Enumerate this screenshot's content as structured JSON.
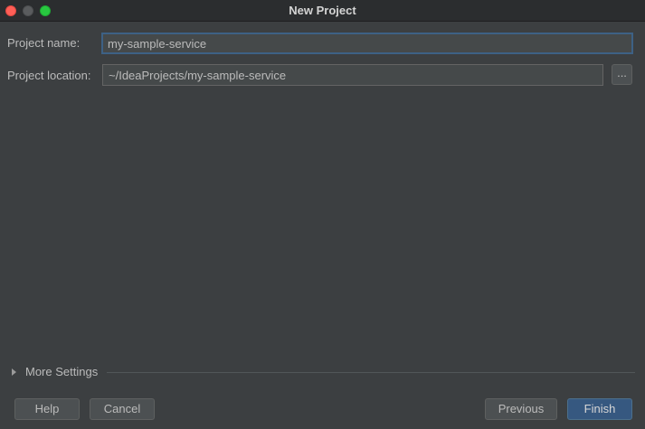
{
  "window": {
    "title": "New Project"
  },
  "form": {
    "project_name_label": "Project name:",
    "project_name_value": "my-sample-service",
    "project_location_label": "Project location:",
    "project_location_value": "~/IdeaProjects/my-sample-service",
    "browse_label": "..."
  },
  "more_settings": {
    "label": "More Settings"
  },
  "buttons": {
    "help": "Help",
    "cancel": "Cancel",
    "previous": "Previous",
    "finish": "Finish"
  },
  "colors": {
    "background": "#3c3f41",
    "accent": "#365880",
    "focus_border": "#3d6185"
  }
}
